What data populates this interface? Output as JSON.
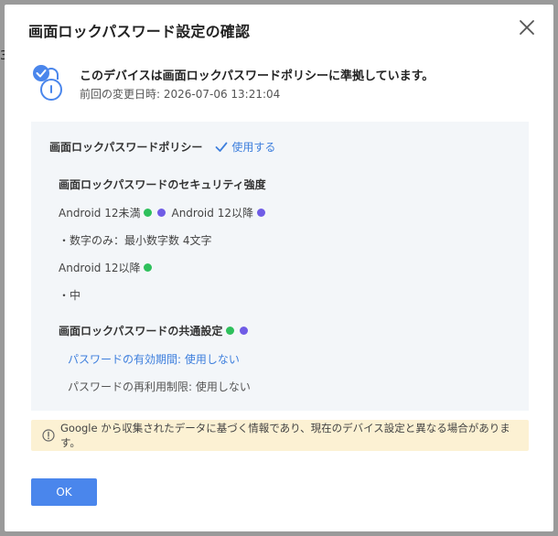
{
  "background": {
    "partial_char": "3"
  },
  "dialog": {
    "title": "画面ロックパスワード設定の確認",
    "compliance_message": "このデバイスは画面ロックパスワードポリシーに準拠しています。",
    "last_changed_label": "前回の変更日時: 2026-07-06 13:21:04",
    "policy": {
      "label": "画面ロックパスワードポリシー",
      "status": "使用する"
    },
    "security": {
      "title": "画面ロックパスワードのセキュリティ強度",
      "android_below_12": "Android 12未満",
      "android_12_above": "Android 12以降",
      "numeric_only": "・数字のみ：最小数字数 4文字",
      "android_12_above_2": "Android 12以降",
      "level": "・中"
    },
    "common": {
      "title": "画面ロックパスワードの共通設定",
      "expiry": "パスワードの有効期間: 使用しない",
      "reuse": "パスワードの再利用制限: 使用しない"
    },
    "notice": "Google から収集されたデータに基づく情報であり、現在のデバイス設定と異なる場合があります。",
    "ok_label": "OK"
  },
  "colors": {
    "accent": "#4a86ec",
    "link": "#3e7fdd",
    "green_dot": "#2ec05c",
    "purple_dot": "#6f5ce6",
    "notice_bg": "#fcf1d3",
    "panel_bg": "#f3f6f9"
  },
  "icons": {
    "close": "close-icon",
    "lock": "lock-check-icon",
    "check": "check-icon",
    "info": "info-icon"
  }
}
